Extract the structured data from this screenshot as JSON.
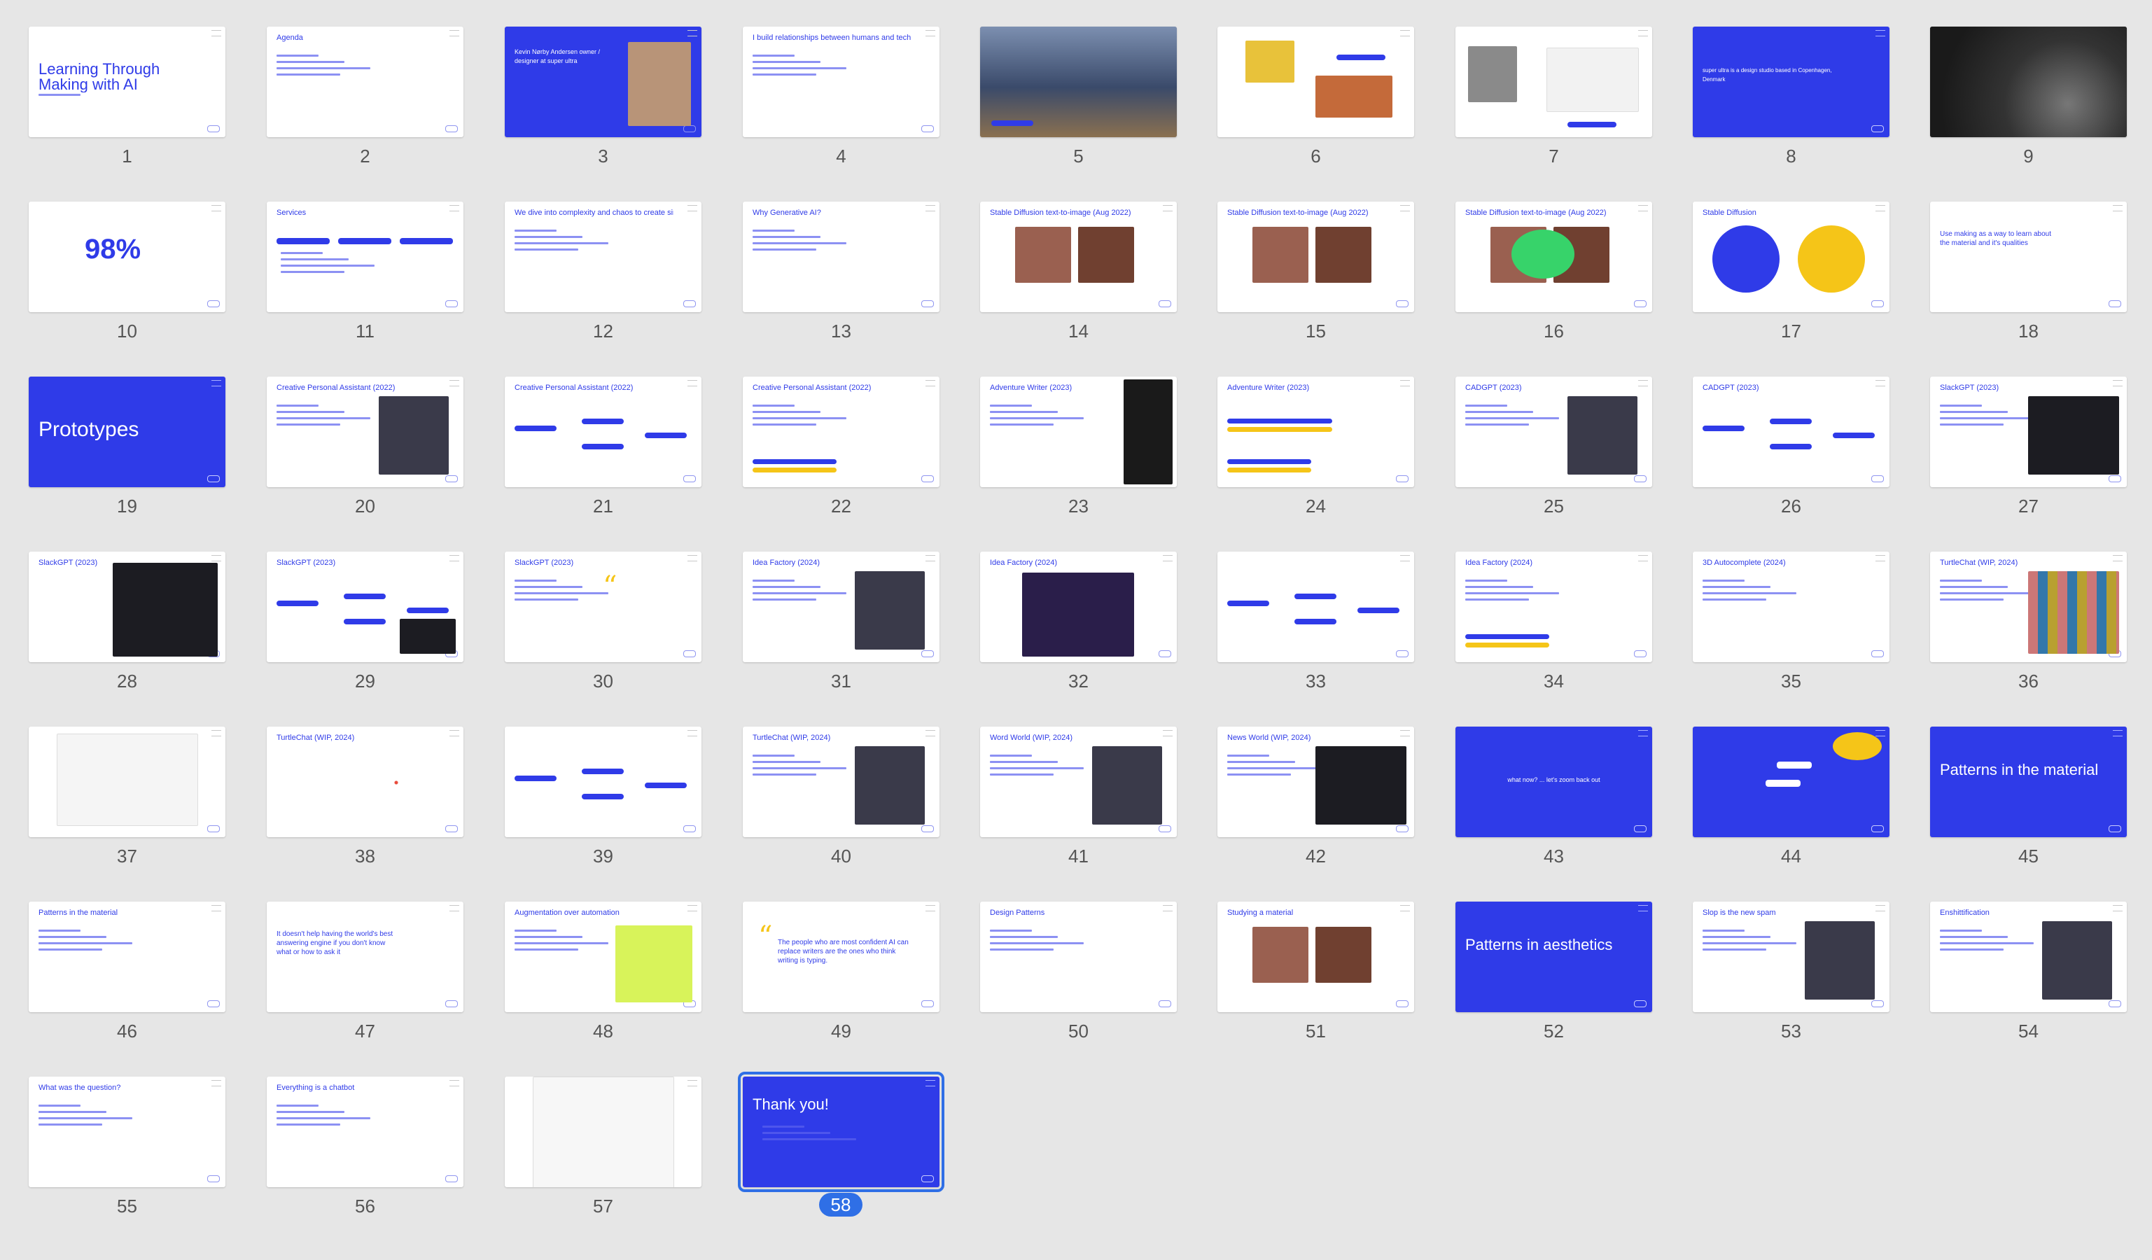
{
  "colors": {
    "background": "#e6e6e6",
    "accent": "#2f3be8",
    "selection": "#2f6fe6"
  },
  "selected_slide": 58,
  "slides": [
    {
      "n": "1",
      "title": "Learning Through Making with AI",
      "type": "title"
    },
    {
      "n": "2",
      "title": "Agenda",
      "type": "list"
    },
    {
      "n": "3",
      "title": "Kevin Nørby Andersen owner / designer at super ultra",
      "type": "intro"
    },
    {
      "n": "4",
      "title": "I build relationships between humans and technology",
      "type": "list"
    },
    {
      "n": "5",
      "title": "",
      "type": "photo"
    },
    {
      "n": "6",
      "title": "",
      "type": "lego"
    },
    {
      "n": "7",
      "title": "",
      "type": "product"
    },
    {
      "n": "8",
      "title": "super ultra is a design studio based in Copenhagen, Denmark",
      "type": "blue-text"
    },
    {
      "n": "9",
      "title": "",
      "type": "dark-photo"
    },
    {
      "n": "10",
      "title": "98%",
      "type": "pct"
    },
    {
      "n": "11",
      "title": "Services",
      "type": "services"
    },
    {
      "n": "12",
      "title": "We dive into complexity and chaos to create simplicity",
      "type": "list"
    },
    {
      "n": "13",
      "title": "Why Generative AI?",
      "type": "list"
    },
    {
      "n": "14",
      "title": "Stable Diffusion text-to-image (Aug 2022)",
      "type": "imgs"
    },
    {
      "n": "15",
      "title": "Stable Diffusion text-to-image (Aug 2022)",
      "type": "imgs"
    },
    {
      "n": "16",
      "title": "Stable Diffusion text-to-image (Aug 2022)",
      "type": "imgs-badge"
    },
    {
      "n": "17",
      "title": "Stable Diffusion",
      "type": "circles"
    },
    {
      "n": "18",
      "title": "Use making as a way to learn about the material and it's qualities",
      "type": "text"
    },
    {
      "n": "19",
      "title": "Prototypes",
      "type": "blue-big"
    },
    {
      "n": "20",
      "title": "Creative Personal Assistant (2022)",
      "type": "list-img"
    },
    {
      "n": "21",
      "title": "Creative Personal Assistant (2022)",
      "type": "flow"
    },
    {
      "n": "22",
      "title": "Creative Personal Assistant (2022)",
      "type": "list-pills"
    },
    {
      "n": "23",
      "title": "Adventure Writer (2023)",
      "type": "list-phone"
    },
    {
      "n": "24",
      "title": "Adventure Writer (2023)",
      "type": "pills"
    },
    {
      "n": "25",
      "title": "CADGPT (2023)",
      "type": "list-img"
    },
    {
      "n": "26",
      "title": "CADGPT (2023)",
      "type": "flow"
    },
    {
      "n": "27",
      "title": "SlackGPT (2023)",
      "type": "list-dark"
    },
    {
      "n": "28",
      "title": "SlackGPT (2023)",
      "type": "dark-panel"
    },
    {
      "n": "29",
      "title": "SlackGPT (2023)",
      "type": "flow-dark"
    },
    {
      "n": "30",
      "title": "SlackGPT (2023)",
      "type": "list-quote"
    },
    {
      "n": "31",
      "title": "Idea Factory (2024)",
      "type": "list-img"
    },
    {
      "n": "32",
      "title": "Idea Factory (2024)",
      "type": "purple"
    },
    {
      "n": "33",
      "title": "",
      "type": "flow"
    },
    {
      "n": "34",
      "title": "Idea Factory (2024)",
      "type": "list-pills"
    },
    {
      "n": "35",
      "title": "3D Autocomplete (2024)",
      "type": "list"
    },
    {
      "n": "36",
      "title": "TurtleChat (WIP, 2024)",
      "type": "list-grid"
    },
    {
      "n": "37",
      "title": "",
      "type": "browser"
    },
    {
      "n": "38",
      "title": "TurtleChat (WIP, 2024)",
      "type": "turtle"
    },
    {
      "n": "39",
      "title": "",
      "type": "flow"
    },
    {
      "n": "40",
      "title": "TurtleChat (WIP, 2024)",
      "type": "list-img"
    },
    {
      "n": "41",
      "title": "Word World (WIP, 2024)",
      "type": "list-img"
    },
    {
      "n": "42",
      "title": "News World (WIP, 2024)",
      "type": "list-dark"
    },
    {
      "n": "43",
      "title": "what now? ... let's zoom back out",
      "type": "blue-center"
    },
    {
      "n": "44",
      "title": "",
      "type": "blue-diagram"
    },
    {
      "n": "45",
      "title": "Patterns in the material",
      "type": "blue-big2"
    },
    {
      "n": "46",
      "title": "Patterns in the material",
      "type": "list"
    },
    {
      "n": "47",
      "title": "It doesn't help having the world's best answering engine if you don't know what or how to ask it",
      "type": "text"
    },
    {
      "n": "48",
      "title": "Augmentation over automation",
      "type": "text-img"
    },
    {
      "n": "49",
      "title": "The people who are most confident AI can replace writers are the ones who think writing is typing.",
      "type": "quote"
    },
    {
      "n": "50",
      "title": "Design Patterns",
      "type": "list"
    },
    {
      "n": "51",
      "title": "Studying a material",
      "type": "imgs"
    },
    {
      "n": "52",
      "title": "Patterns in aesthetics",
      "type": "blue-big2"
    },
    {
      "n": "53",
      "title": "Slop is the new spam",
      "type": "list-img"
    },
    {
      "n": "54",
      "title": "Enshittification",
      "type": "list-img"
    },
    {
      "n": "55",
      "title": "What was the question?",
      "type": "list"
    },
    {
      "n": "56",
      "title": "Everything is a chatbot",
      "type": "list"
    },
    {
      "n": "57",
      "title": "",
      "type": "screenshot"
    },
    {
      "n": "58",
      "title": "Thank you!",
      "type": "thanks"
    }
  ]
}
